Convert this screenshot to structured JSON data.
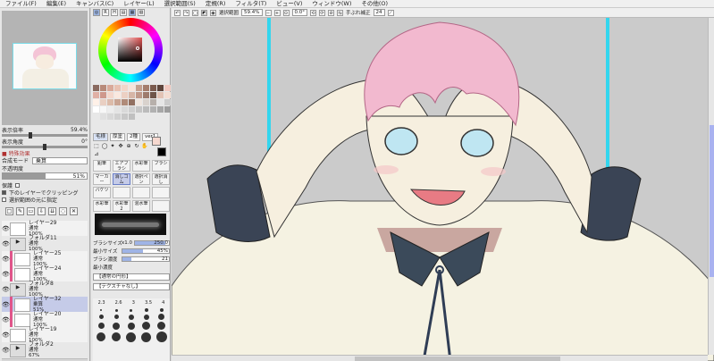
{
  "menu": [
    "ファイル(F)",
    "編集(E)",
    "キャンバス(C)",
    "レイヤー(L)",
    "選択範囲(S)",
    "定規(R)",
    "フィルタ(T)",
    "ビュー(V)",
    "ウィンドウ(W)",
    "その他(O)"
  ],
  "navigator": {
    "zoom_label": "表示倍率",
    "zoom_value": "59.4%",
    "rotate_label": "表示角度",
    "rotate_value": "0°"
  },
  "layer_props": {
    "section_title": "■ 特殊効果",
    "blend_label": "合成モード",
    "blend_value": "乗算",
    "opacity_label": "不透明度",
    "opacity_value": "51%",
    "opacity_level": 0.51,
    "protect_label": "保護",
    "clip_label": "下のレイヤーでクリッピング",
    "select_src_label": "選択範囲の元に指定"
  },
  "layers": [
    {
      "name": "レイヤー29",
      "mode": "通常",
      "opacity": "100%",
      "type": "layer",
      "clip": false,
      "selected": false
    },
    {
      "name": "フォルダ11",
      "mode": "通常",
      "opacity": "100%",
      "type": "folder",
      "clip": false,
      "selected": false
    },
    {
      "name": "レイヤー25",
      "mode": "通常",
      "opacity": "100%",
      "type": "layer",
      "clip": true,
      "selected": false
    },
    {
      "name": "レイヤー24",
      "mode": "通常",
      "opacity": "100%",
      "type": "layer",
      "clip": true,
      "selected": false
    },
    {
      "name": "フォルダ8",
      "mode": "通常",
      "opacity": "100%",
      "type": "folder",
      "clip": false,
      "selected": false
    },
    {
      "name": "レイヤー32",
      "mode": "乗算",
      "opacity": "51%",
      "type": "layer",
      "clip": true,
      "selected": true
    },
    {
      "name": "レイヤー20",
      "mode": "通常",
      "opacity": "100%",
      "type": "layer",
      "clip": true,
      "selected": false
    },
    {
      "name": "レイヤー19",
      "mode": "通常",
      "opacity": "100%",
      "type": "layer",
      "clip": false,
      "selected": false
    },
    {
      "name": "フォルダ2",
      "mode": "通常",
      "opacity": "67%",
      "type": "folder",
      "clip": false,
      "selected": false
    }
  ],
  "tool_tabs": [
    "毛様",
    "厚塗",
    "2種",
    "ver1"
  ],
  "brushes": [
    {
      "label": "鉛筆",
      "selected": false
    },
    {
      "label": "エアブラシ",
      "selected": false
    },
    {
      "label": "水彩筆",
      "selected": false
    },
    {
      "label": "ブラシ",
      "selected": false
    },
    {
      "label": "マーカー",
      "selected": false
    },
    {
      "label": "消しゴム",
      "selected": true
    },
    {
      "label": "選択ペン",
      "selected": false
    },
    {
      "label": "選択消し",
      "selected": false
    },
    {
      "label": "バケツ",
      "selected": false
    },
    {
      "label": "",
      "selected": false
    },
    {
      "label": "",
      "selected": false
    },
    {
      "label": "",
      "selected": false
    },
    {
      "label": "水彩筆",
      "selected": false
    },
    {
      "label": "水彩筆2",
      "selected": false
    },
    {
      "label": "混水筆",
      "selected": false
    },
    {
      "label": "",
      "selected": false
    }
  ],
  "brush_props": {
    "size_label": "ブラシサイズ",
    "size_mult": "x1.0",
    "size_value": "250.0",
    "size_level": 0.9,
    "minsize_label": "最小サイズ",
    "minsize_value": "45%",
    "minsize_level": 0.45,
    "density_label": "ブラシ濃度",
    "density_value": "21",
    "density_level": 0.2,
    "mindensity_label": "最小濃度",
    "shape_value": "【通常の円形】",
    "texture_value": "【テクスチャなし】"
  },
  "size_presets": [
    "2.3",
    "2.6",
    "3",
    "3.5",
    "4"
  ],
  "canvas_toolbar": {
    "stabilize_label": "選択範囲",
    "zoom_value": "59.4%",
    "angle_value": "0.0°",
    "correction_label": "手ぶれ補正",
    "correction_value": "24"
  },
  "colors": {
    "accent_selected": "#c5cbe8",
    "clip_marker": "#e0558a",
    "guide_line": "#33d6ee",
    "main_color": "#f6d8cf"
  }
}
